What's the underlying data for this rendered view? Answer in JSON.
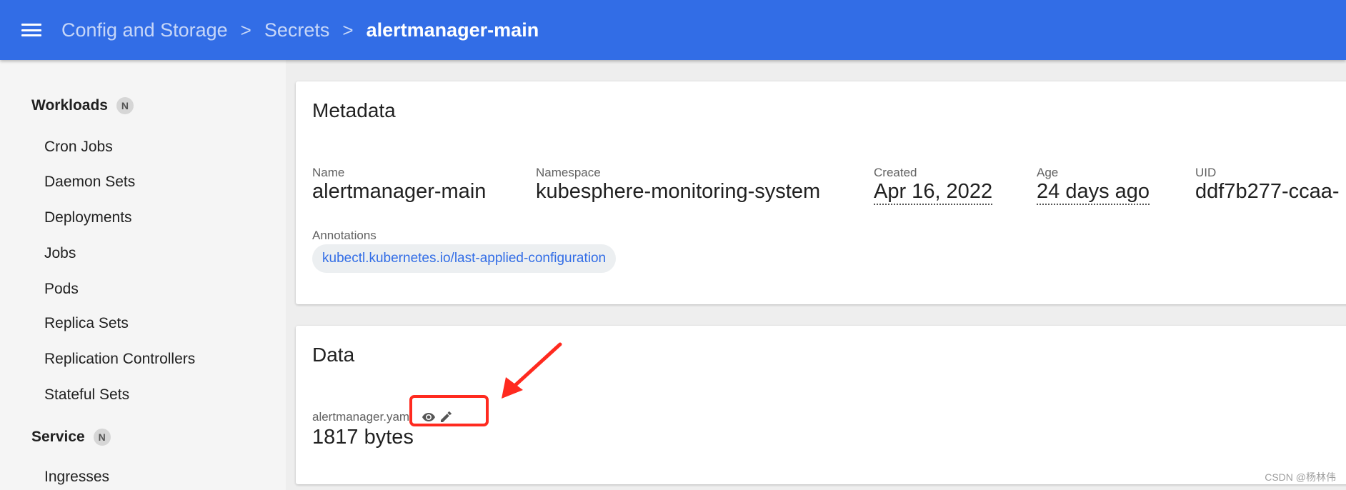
{
  "toolbar": {
    "menu_icon": "menu-icon",
    "breadcrumbs": [
      "Config and Storage",
      "Secrets"
    ],
    "current": "alertmanager-main",
    "separator": ">",
    "color": "#326de6"
  },
  "sidebar": {
    "workloads": {
      "label": "Workloads",
      "badge": "N"
    },
    "workload_items": [
      "Cron Jobs",
      "Daemon Sets",
      "Deployments",
      "Jobs",
      "Pods",
      "Replica Sets",
      "Replication Controllers",
      "Stateful Sets"
    ],
    "service": {
      "label": "Service",
      "badge": "N"
    },
    "service_items": [
      "Ingresses"
    ]
  },
  "metadata": {
    "title": "Metadata",
    "name_label": "Name",
    "name_value": "alertmanager-main",
    "namespace_label": "Namespace",
    "namespace_value": "kubesphere-monitoring-system",
    "created_label": "Created",
    "created_value": "Apr 16, 2022",
    "age_label": "Age",
    "age_value": "24 days ago",
    "uid_label": "UID",
    "uid_value": "ddf7b277-ccaa-",
    "annotations_label": "Annotations",
    "annotation_chip": "kubectl.kubernetes.io/last-applied-configuration"
  },
  "data_card": {
    "title": "Data",
    "key": "alertmanager.yaml",
    "view_icon": "eye-icon",
    "edit_icon": "pencil-icon",
    "value": "1817 bytes"
  },
  "annotation_color": "#ff2a1f",
  "watermark": "CSDN @杨林伟"
}
